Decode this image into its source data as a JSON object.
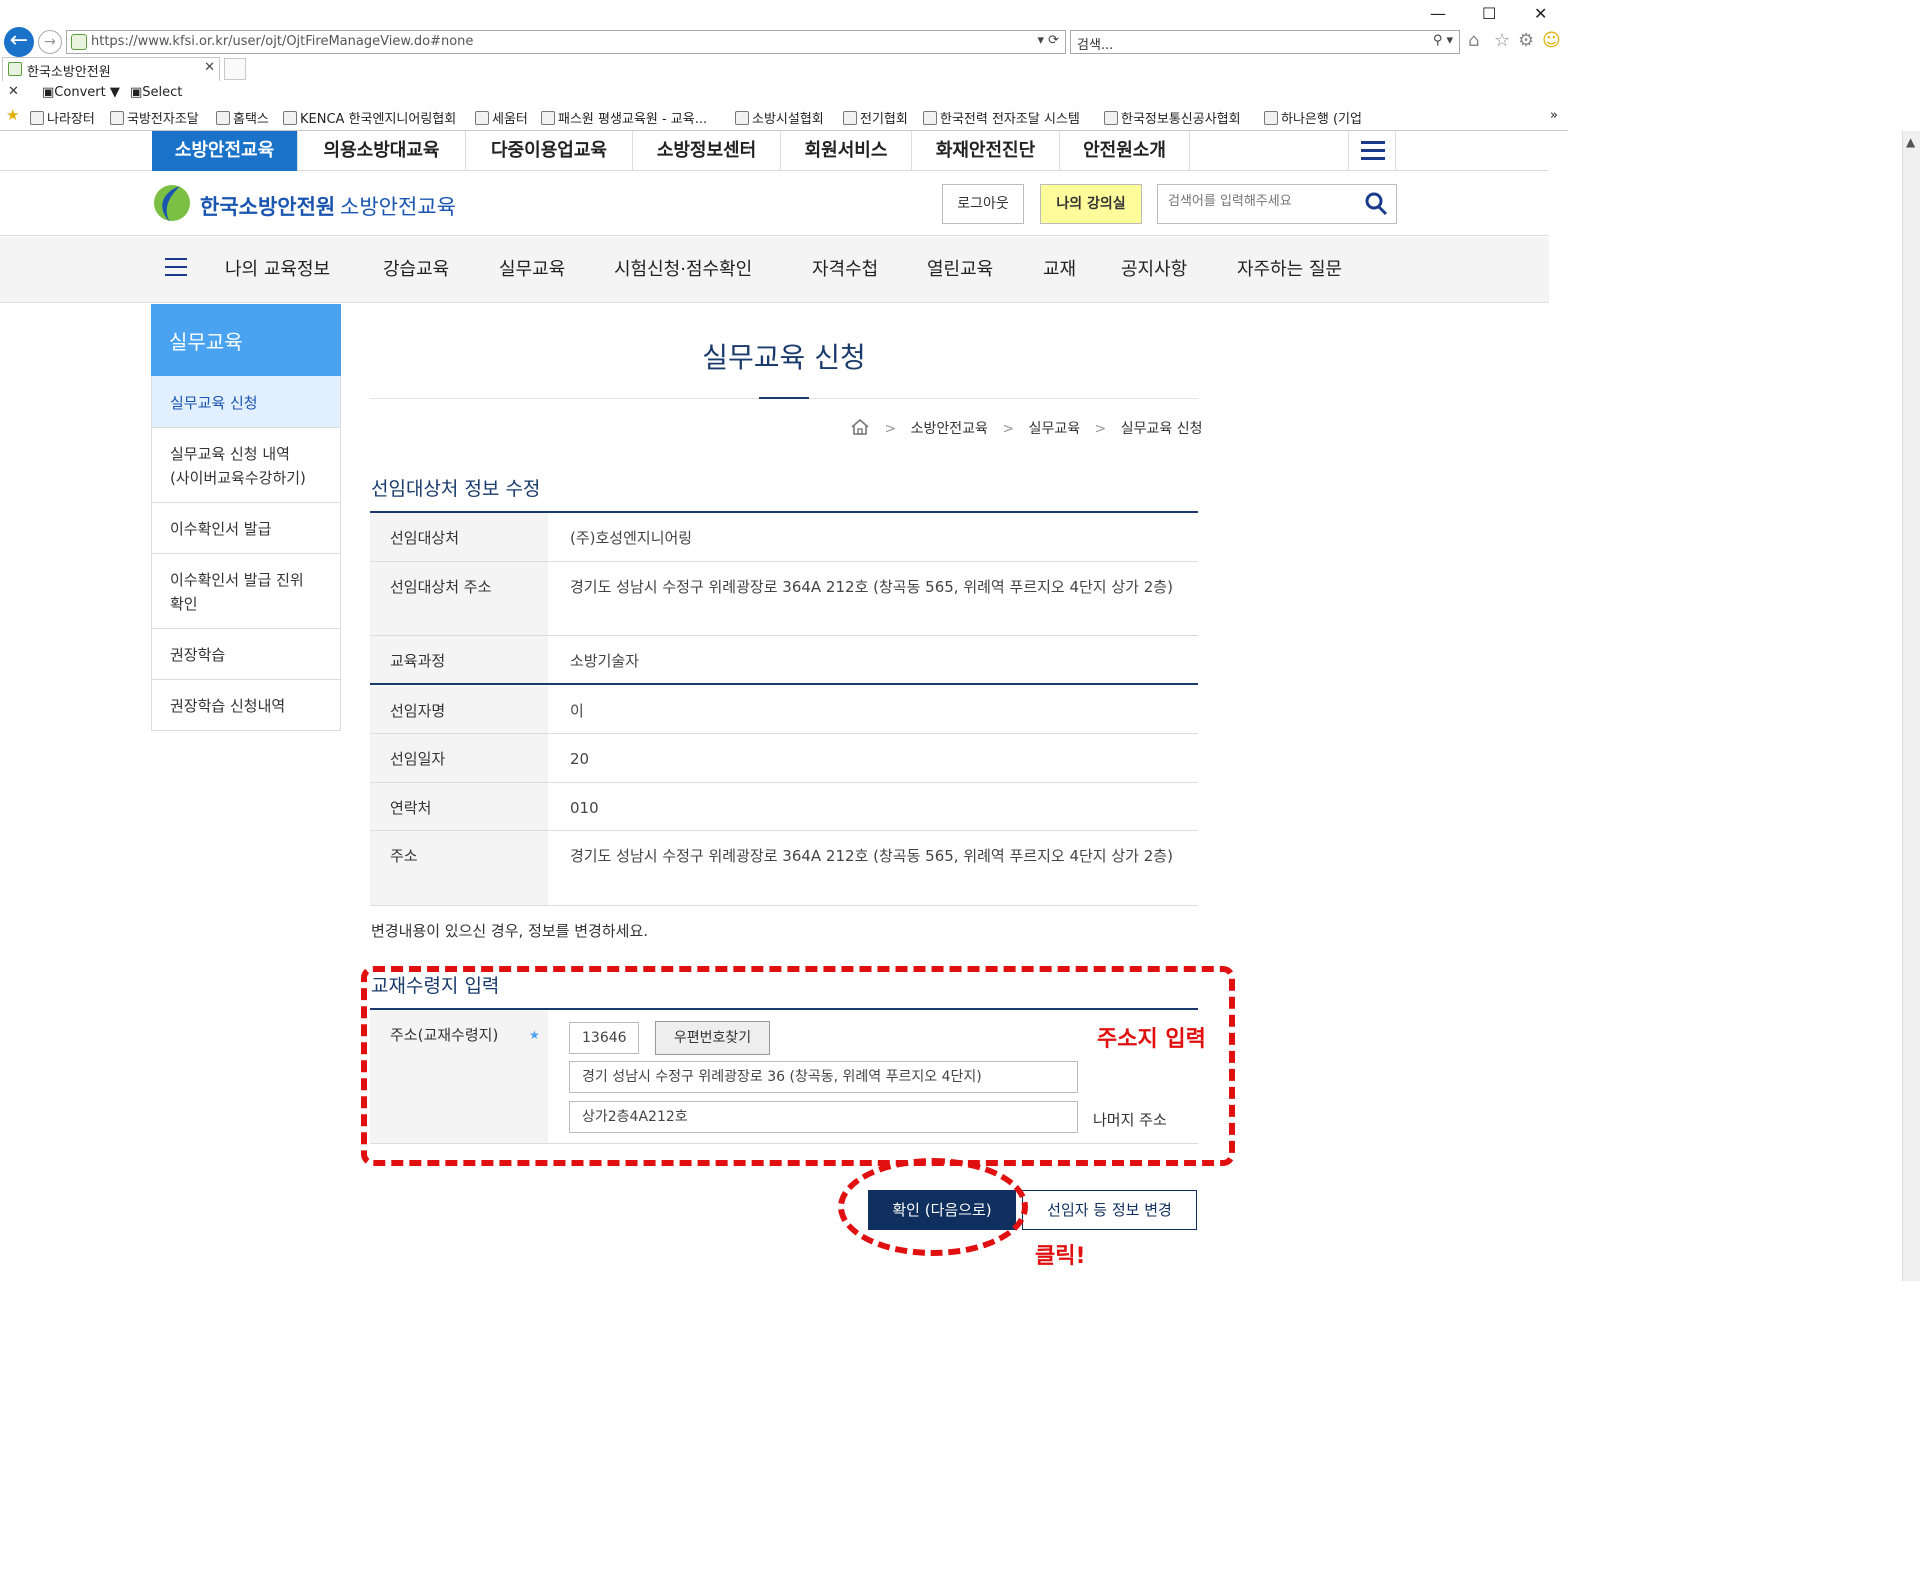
{
  "browser": {
    "url": "https://www.kfsi.or.kr/user/ojt/OjtFireManageView.do#none",
    "search_placeholder": "검색...",
    "tab_title": "한국소방안전원",
    "cmd_convert": "Convert",
    "cmd_select": "Select",
    "favorites": [
      "나라장터",
      "국방전자조달",
      "홈택스",
      "KENCA 한국엔지니어링협회",
      "세움터",
      "패스원 평생교육원 - 교육...",
      "소방시설협회",
      "전기협회",
      "한국전력 전자조달 시스템",
      "한국정보통신공사협회",
      "하나은행 (기업"
    ]
  },
  "top_nav": [
    "소방안전교육",
    "의용소방대교육",
    "다중이용업교육",
    "소방정보센터",
    "회원서비스",
    "화재안전진단",
    "안전원소개"
  ],
  "brand": {
    "name": "한국소방안전원",
    "sub": "소방안전교육",
    "logout": "로그아웃",
    "my_class": "나의 강의실",
    "search_placeholder": "검색어를 입력해주세요"
  },
  "gnb": [
    "나의 교육정보",
    "강습교육",
    "실무교육",
    "시험신청·점수확인",
    "자격수첩",
    "열린교육",
    "교재",
    "공지사항",
    "자주하는 질문"
  ],
  "sidebar": {
    "title": "실무교육",
    "items": [
      "실무교육 신청",
      "실무교육 신청 내역\n(사이버교육수강하기)",
      "이수확인서 발급",
      "이수확인서 발급 진위\n확인",
      "권장학습",
      "권장학습 신청내역"
    ]
  },
  "page": {
    "title": "실무교육 신청",
    "breadcrumb": [
      "소방안전교육",
      "실무교육",
      "실무교육 신청"
    ]
  },
  "section1": {
    "title": "선임대상처 정보 수정",
    "rows": [
      {
        "label": "선임대상처",
        "value": "(주)호성엔지니어링"
      },
      {
        "label": "선임대상처 주소",
        "value": "경기도 성남시 수정구 위례광장로 364A 212호 (창곡동 565, 위례역 푸르지오 4단지 상가 2층)"
      },
      {
        "label": "교육과정",
        "value": "소방기술자"
      },
      {
        "label": "선임자명",
        "value": "이"
      },
      {
        "label": "선임일자",
        "value": "20"
      },
      {
        "label": "연락처",
        "value": "010"
      },
      {
        "label": "주소",
        "value": "경기도 성남시 수정구 위례광장로 364A 212호 (창곡동 565, 위례역 푸르지오 4단지 상가 2층)"
      }
    ],
    "note": "변경내용이 있으신 경우, 정보를 변경하세요."
  },
  "section2": {
    "title": "교재수령지 입력",
    "label": "주소(교재수령지)",
    "zip": "13646",
    "zip_button": "우편번호찾기",
    "address1": "경기 성남시 수정구 위례광장로 36 (창곡동, 위례역 푸르지오 4단지)",
    "address2": "상가2층4A212호",
    "remain_label": "나머지 주소"
  },
  "annotations": {
    "address_hint": "주소지 입력",
    "click_hint": "클릭!"
  },
  "buttons": {
    "confirm": "확인 (다음으로)",
    "change": "선임자 등 정보 변경"
  },
  "colors": {
    "primary": "#1a72c9",
    "navy": "#0f2f5e",
    "highlight": "#fefc9a",
    "annotation": "#e01010"
  }
}
